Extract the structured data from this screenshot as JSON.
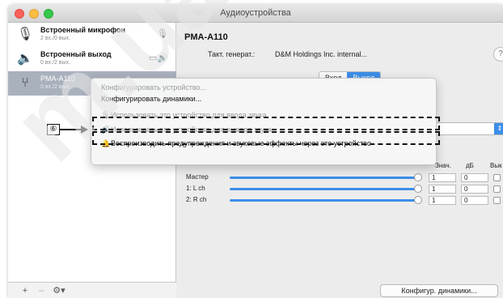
{
  "window": {
    "title": "Аудиоустройства"
  },
  "sidebar": {
    "devices": [
      {
        "name": "Встроенный микрофон",
        "sub": "2 вх./0 вых.",
        "icon": "microphone-icon"
      },
      {
        "name": "Встроенный выход",
        "sub": "0 вх./2 вых.",
        "icon": "speaker-icon"
      },
      {
        "name": "PMA-A110",
        "sub": "0 вх./2 вых.",
        "icon": "usb-icon"
      }
    ],
    "add_label": "+",
    "remove_label": "–",
    "gear_label": "⚙▾"
  },
  "main": {
    "device_title": "PMA-A110",
    "clock_label": "Такт. генерат.:",
    "clock_value": "D&M Holdings Inc. internal...",
    "help_label": "?",
    "tabs": [
      {
        "label": "Вход"
      },
      {
        "label": "Выход"
      }
    ],
    "columns": {
      "value": "Знач.",
      "db": "дБ",
      "mute": "Вык"
    },
    "channels": [
      {
        "label": "Мастер",
        "value": "1",
        "db": "0"
      },
      {
        "label": "1: L ch",
        "value": "1",
        "db": "0"
      },
      {
        "label": "2: R ch",
        "value": "1",
        "db": "0"
      }
    ],
    "configure_button": "Конфигур. динамики..."
  },
  "context_menu": {
    "items": [
      {
        "label": "Конфигурировать устройство...",
        "enabled": false
      },
      {
        "label": "Конфигурировать динамики...",
        "enabled": true
      },
      {
        "label": "Использовать это устройство для ввода звука",
        "enabled": false
      },
      {
        "label": "Использовать это устройство для вывода звука",
        "enabled": false
      },
      {
        "label": "Воспроизводить предупреждения и звуковые эффекты через это устройство",
        "enabled": true
      }
    ]
  },
  "callout": {
    "number": "⑥"
  },
  "watermark": {
    "text": "m.ua"
  }
}
